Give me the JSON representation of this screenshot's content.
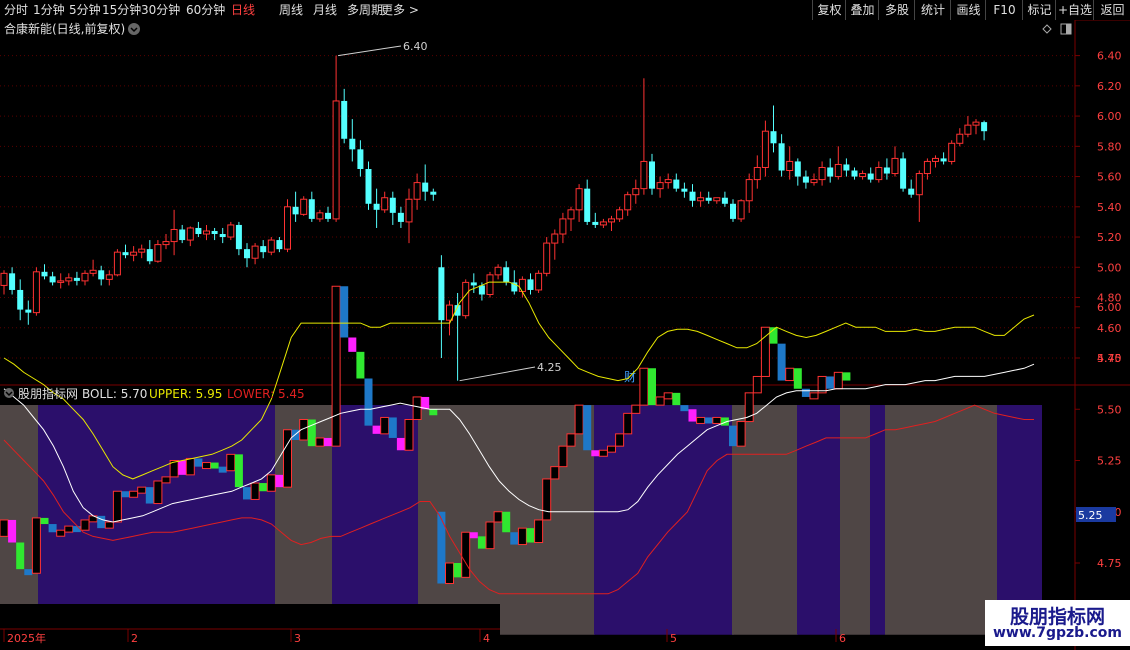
{
  "toolbar": {
    "periods": [
      "分时",
      "1分钟",
      "5分钟",
      "15分钟",
      "30分钟",
      "60分钟",
      "日线",
      "周线",
      "月线",
      "多周期",
      "更多 >"
    ],
    "active_period": "日线",
    "right_buttons": [
      "复权",
      "叠加",
      "多股",
      "统计",
      "画线",
      "F10",
      "标记",
      "+自选",
      "返回"
    ]
  },
  "main": {
    "title": "合康新能(日线,前复权)",
    "y_labels": [
      "6.40",
      "6.20",
      "6.00",
      "5.80",
      "5.60",
      "5.40",
      "5.20",
      "5.00",
      "4.80",
      "4.60",
      "4.40"
    ],
    "high_label": "6.40",
    "low_label": "4.25",
    "event_marker": "财"
  },
  "indicator": {
    "name": "股朋指标网",
    "boll_label": "BOLL: 5.70",
    "upper_label": "UPPER: 5.95",
    "lower_label": "LOWER: 5.45",
    "y_labels": [
      "6.00",
      "5.75",
      "5.50",
      "5.25",
      "5.00",
      "4.75"
    ],
    "current_value": "5.25"
  },
  "time_axis": [
    "2025年",
    "2",
    "3",
    "4",
    "5",
    "6"
  ],
  "watermark": {
    "title": "股朋指标网",
    "url": "www.7gpzb.com"
  },
  "colors": {
    "up": "#ff3232",
    "down": "#54ffff",
    "upper": "#e8e800",
    "lower": "#e02020",
    "mid": "#ffffff",
    "purple": "#2b0f6b",
    "gray": "#4f4645"
  },
  "chart_data": {
    "type": "candlestick",
    "title": "合康新能(日线,前复权)",
    "ylim": [
      4.25,
      6.45
    ],
    "candles": [
      [
        4.88,
        4.98,
        4.82,
        4.96
      ],
      [
        4.96,
        5.0,
        4.82,
        4.85
      ],
      [
        4.85,
        4.92,
        4.65,
        4.72
      ],
      [
        4.72,
        4.78,
        4.62,
        4.7
      ],
      [
        4.7,
        5.0,
        4.68,
        4.97
      ],
      [
        4.97,
        5.02,
        4.92,
        4.94
      ],
      [
        4.94,
        4.97,
        4.88,
        4.9
      ],
      [
        4.9,
        4.96,
        4.86,
        4.91
      ],
      [
        4.91,
        4.96,
        4.88,
        4.93
      ],
      [
        4.93,
        4.97,
        4.88,
        4.91
      ],
      [
        4.91,
        4.98,
        4.88,
        4.96
      ],
      [
        4.96,
        5.05,
        4.94,
        4.98
      ],
      [
        4.98,
        5.01,
        4.88,
        4.92
      ],
      [
        4.92,
        4.98,
        4.88,
        4.95
      ],
      [
        4.95,
        5.12,
        4.94,
        5.1
      ],
      [
        5.1,
        5.15,
        5.06,
        5.08
      ],
      [
        5.08,
        5.14,
        5.04,
        5.1
      ],
      [
        5.1,
        5.15,
        5.06,
        5.12
      ],
      [
        5.12,
        5.18,
        5.02,
        5.04
      ],
      [
        5.04,
        5.18,
        5.03,
        5.15
      ],
      [
        5.15,
        5.22,
        5.12,
        5.17
      ],
      [
        5.17,
        5.38,
        5.08,
        5.25
      ],
      [
        5.25,
        5.28,
        5.16,
        5.18
      ],
      [
        5.18,
        5.27,
        5.14,
        5.26
      ],
      [
        5.26,
        5.3,
        5.2,
        5.22
      ],
      [
        5.22,
        5.28,
        5.18,
        5.24
      ],
      [
        5.24,
        5.26,
        5.18,
        5.22
      ],
      [
        5.22,
        5.26,
        5.16,
        5.2
      ],
      [
        5.2,
        5.3,
        5.18,
        5.28
      ],
      [
        5.28,
        5.3,
        5.08,
        5.12
      ],
      [
        5.12,
        5.16,
        5.0,
        5.06
      ],
      [
        5.06,
        5.16,
        5.02,
        5.14
      ],
      [
        5.14,
        5.18,
        5.06,
        5.1
      ],
      [
        5.1,
        5.2,
        5.08,
        5.18
      ],
      [
        5.18,
        5.2,
        5.1,
        5.12
      ],
      [
        5.12,
        5.45,
        5.1,
        5.4
      ],
      [
        5.4,
        5.5,
        5.3,
        5.35
      ],
      [
        5.35,
        5.47,
        5.34,
        5.45
      ],
      [
        5.45,
        5.5,
        5.3,
        5.32
      ],
      [
        5.32,
        5.38,
        5.3,
        5.36
      ],
      [
        5.36,
        5.4,
        5.3,
        5.32
      ],
      [
        5.32,
        6.4,
        5.3,
        6.1
      ],
      [
        6.1,
        6.18,
        5.82,
        5.85
      ],
      [
        5.85,
        5.98,
        5.7,
        5.78
      ],
      [
        5.78,
        5.84,
        5.6,
        5.65
      ],
      [
        5.65,
        5.7,
        5.38,
        5.42
      ],
      [
        5.42,
        5.52,
        5.26,
        5.38
      ],
      [
        5.38,
        5.5,
        5.36,
        5.46
      ],
      [
        5.46,
        5.5,
        5.28,
        5.36
      ],
      [
        5.36,
        5.4,
        5.26,
        5.3
      ],
      [
        5.3,
        5.52,
        5.16,
        5.45
      ],
      [
        5.45,
        5.62,
        5.38,
        5.56
      ],
      [
        5.56,
        5.68,
        5.44,
        5.5
      ],
      [
        5.5,
        5.52,
        5.44,
        5.48
      ],
      [
        5.0,
        5.08,
        4.4,
        4.65
      ],
      [
        4.65,
        4.78,
        4.55,
        4.75
      ],
      [
        4.75,
        4.83,
        4.25,
        4.68
      ],
      [
        4.68,
        4.92,
        4.66,
        4.9
      ],
      [
        4.9,
        4.96,
        4.83,
        4.88
      ],
      [
        4.88,
        4.9,
        4.78,
        4.82
      ],
      [
        4.82,
        4.97,
        4.8,
        4.95
      ],
      [
        4.95,
        5.02,
        4.92,
        5.0
      ],
      [
        5.0,
        5.04,
        4.88,
        4.9
      ],
      [
        4.9,
        4.98,
        4.82,
        4.84
      ],
      [
        4.84,
        4.94,
        4.8,
        4.92
      ],
      [
        4.92,
        4.96,
        4.82,
        4.85
      ],
      [
        4.85,
        4.98,
        4.83,
        4.96
      ],
      [
        4.96,
        5.2,
        4.94,
        5.16
      ],
      [
        5.16,
        5.25,
        5.05,
        5.22
      ],
      [
        5.22,
        5.36,
        5.16,
        5.32
      ],
      [
        5.32,
        5.4,
        5.24,
        5.38
      ],
      [
        5.38,
        5.55,
        5.3,
        5.52
      ],
      [
        5.52,
        5.58,
        5.28,
        5.3
      ],
      [
        5.3,
        5.36,
        5.26,
        5.28
      ],
      [
        5.28,
        5.32,
        5.26,
        5.3
      ],
      [
        5.3,
        5.34,
        5.24,
        5.32
      ],
      [
        5.32,
        5.4,
        5.3,
        5.38
      ],
      [
        5.38,
        5.5,
        5.34,
        5.48
      ],
      [
        5.48,
        5.58,
        5.42,
        5.52
      ],
      [
        5.52,
        6.25,
        5.48,
        5.7
      ],
      [
        5.7,
        5.75,
        5.48,
        5.52
      ],
      [
        5.52,
        5.6,
        5.46,
        5.56
      ],
      [
        5.56,
        5.62,
        5.52,
        5.58
      ],
      [
        5.58,
        5.62,
        5.5,
        5.52
      ],
      [
        5.52,
        5.56,
        5.46,
        5.5
      ],
      [
        5.5,
        5.55,
        5.4,
        5.44
      ],
      [
        5.44,
        5.5,
        5.4,
        5.46
      ],
      [
        5.46,
        5.5,
        5.42,
        5.44
      ],
      [
        5.44,
        5.46,
        5.42,
        5.46
      ],
      [
        5.46,
        5.5,
        5.4,
        5.42
      ],
      [
        5.42,
        5.45,
        5.3,
        5.32
      ],
      [
        5.32,
        5.45,
        5.3,
        5.44
      ],
      [
        5.44,
        5.62,
        5.36,
        5.58
      ],
      [
        5.58,
        5.74,
        5.52,
        5.66
      ],
      [
        5.66,
        5.97,
        5.6,
        5.9
      ],
      [
        5.9,
        6.07,
        5.76,
        5.82
      ],
      [
        5.82,
        5.88,
        5.6,
        5.64
      ],
      [
        5.64,
        5.8,
        5.58,
        5.7
      ],
      [
        5.7,
        5.72,
        5.54,
        5.6
      ],
      [
        5.6,
        5.64,
        5.52,
        5.56
      ],
      [
        5.56,
        5.62,
        5.54,
        5.58
      ],
      [
        5.58,
        5.7,
        5.54,
        5.66
      ],
      [
        5.66,
        5.72,
        5.56,
        5.6
      ],
      [
        5.6,
        5.8,
        5.58,
        5.68
      ],
      [
        5.68,
        5.72,
        5.6,
        5.64
      ],
      [
        5.64,
        5.66,
        5.58,
        5.6
      ],
      [
        5.6,
        5.64,
        5.58,
        5.62
      ],
      [
        5.62,
        5.66,
        5.56,
        5.58
      ],
      [
        5.58,
        5.7,
        5.56,
        5.66
      ],
      [
        5.66,
        5.72,
        5.58,
        5.62
      ],
      [
        5.62,
        5.8,
        5.6,
        5.72
      ],
      [
        5.72,
        5.76,
        5.5,
        5.52
      ],
      [
        5.52,
        5.58,
        5.46,
        5.48
      ],
      [
        5.48,
        5.64,
        5.3,
        5.62
      ],
      [
        5.62,
        5.72,
        5.58,
        5.7
      ],
      [
        5.7,
        5.74,
        5.66,
        5.72
      ],
      [
        5.72,
        5.76,
        5.68,
        5.7
      ],
      [
        5.7,
        5.84,
        5.68,
        5.82
      ],
      [
        5.82,
        5.92,
        5.8,
        5.88
      ],
      [
        5.88,
        6.0,
        5.86,
        5.94
      ],
      [
        5.94,
        5.98,
        5.88,
        5.96
      ],
      [
        5.96,
        5.97,
        5.84,
        5.9
      ]
    ],
    "indicator": {
      "type": "line",
      "series": [
        {
          "name": "UPPER",
          "values": [
            5.75,
            5.72,
            5.68,
            5.65,
            5.62,
            5.58,
            5.55,
            5.5,
            5.45,
            5.38,
            5.3,
            5.22,
            5.18,
            5.16,
            5.18,
            5.2,
            5.22,
            5.24,
            5.25,
            5.26,
            5.27,
            5.28,
            5.3,
            5.32,
            5.35,
            5.4,
            5.45,
            5.55,
            5.7,
            5.85,
            5.92,
            5.92,
            5.92,
            5.92,
            5.92,
            5.92,
            5.92,
            5.9,
            5.9,
            5.92,
            5.92,
            5.92,
            5.92,
            5.92,
            5.92,
            5.92,
            6.02,
            6.08,
            6.1,
            6.12,
            6.12,
            6.12,
            6.1,
            6.02,
            5.92,
            5.85,
            5.8,
            5.75,
            5.7,
            5.68,
            5.66,
            5.65,
            5.64,
            5.65,
            5.7,
            5.78,
            5.85,
            5.88,
            5.89,
            5.89,
            5.88,
            5.86,
            5.84,
            5.82,
            5.8,
            5.8,
            5.82,
            5.86,
            5.9,
            5.88,
            5.86,
            5.85,
            5.86,
            5.88,
            5.9,
            5.92,
            5.9,
            5.9,
            5.9,
            5.88,
            5.88,
            5.88,
            5.89,
            5.88,
            5.88,
            5.89,
            5.9,
            5.9,
            5.9,
            5.88,
            5.86,
            5.86,
            5.9,
            5.94,
            5.96
          ]
        },
        {
          "name": "BOLL",
          "values": [
            5.6,
            5.56,
            5.52,
            5.46,
            5.4,
            5.32,
            5.22,
            5.1,
            5.02,
            4.98,
            4.96,
            4.95,
            4.96,
            4.97,
            4.98,
            5.0,
            5.02,
            5.04,
            5.05,
            5.06,
            5.07,
            5.08,
            5.09,
            5.1,
            5.12,
            5.14,
            5.16,
            5.2,
            5.28,
            5.36,
            5.4,
            5.42,
            5.44,
            5.46,
            5.48,
            5.49,
            5.5,
            5.5,
            5.51,
            5.52,
            5.53,
            5.52,
            5.51,
            5.5,
            5.5,
            5.5,
            5.45,
            5.38,
            5.3,
            5.22,
            5.15,
            5.1,
            5.06,
            5.03,
            5.01,
            5.0,
            5.0,
            5.0,
            5.0,
            5.0,
            5.0,
            5.0,
            5.0,
            5.01,
            5.05,
            5.12,
            5.18,
            5.23,
            5.28,
            5.32,
            5.36,
            5.4,
            5.42,
            5.44,
            5.45,
            5.46,
            5.48,
            5.52,
            5.56,
            5.58,
            5.59,
            5.59,
            5.59,
            5.59,
            5.6,
            5.6,
            5.6,
            5.6,
            5.61,
            5.62,
            5.62,
            5.62,
            5.63,
            5.64,
            5.64,
            5.65,
            5.66,
            5.66,
            5.66,
            5.66,
            5.67,
            5.68,
            5.69,
            5.7,
            5.72
          ]
        },
        {
          "name": "LOWER",
          "values": [
            5.35,
            5.3,
            5.25,
            5.2,
            5.15,
            5.08,
            5.0,
            4.95,
            4.9,
            4.88,
            4.87,
            4.86,
            4.87,
            4.88,
            4.89,
            4.9,
            4.9,
            4.9,
            4.91,
            4.92,
            4.93,
            4.94,
            4.95,
            4.96,
            4.97,
            4.97,
            4.96,
            4.94,
            4.9,
            4.86,
            4.84,
            4.85,
            4.87,
            4.88,
            4.88,
            4.9,
            4.92,
            4.94,
            4.96,
            4.98,
            5.0,
            5.02,
            5.05,
            5.05,
            4.98,
            4.88,
            4.8,
            4.72,
            4.66,
            4.62,
            4.6,
            4.6,
            4.6,
            4.6,
            4.6,
            4.6,
            4.6,
            4.6,
            4.6,
            4.6,
            4.6,
            4.6,
            4.62,
            4.66,
            4.7,
            4.78,
            4.84,
            4.9,
            4.95,
            5.0,
            5.1,
            5.2,
            5.25,
            5.28,
            5.28,
            5.28,
            5.28,
            5.28,
            5.28,
            5.28,
            5.3,
            5.32,
            5.34,
            5.36,
            5.36,
            5.36,
            5.36,
            5.36,
            5.38,
            5.4,
            5.4,
            5.41,
            5.42,
            5.43,
            5.44,
            5.46,
            5.48,
            5.5,
            5.52,
            5.5,
            5.48,
            5.47,
            5.46,
            5.45,
            5.45
          ]
        }
      ],
      "ylim": [
        4.55,
        6.2
      ]
    }
  }
}
